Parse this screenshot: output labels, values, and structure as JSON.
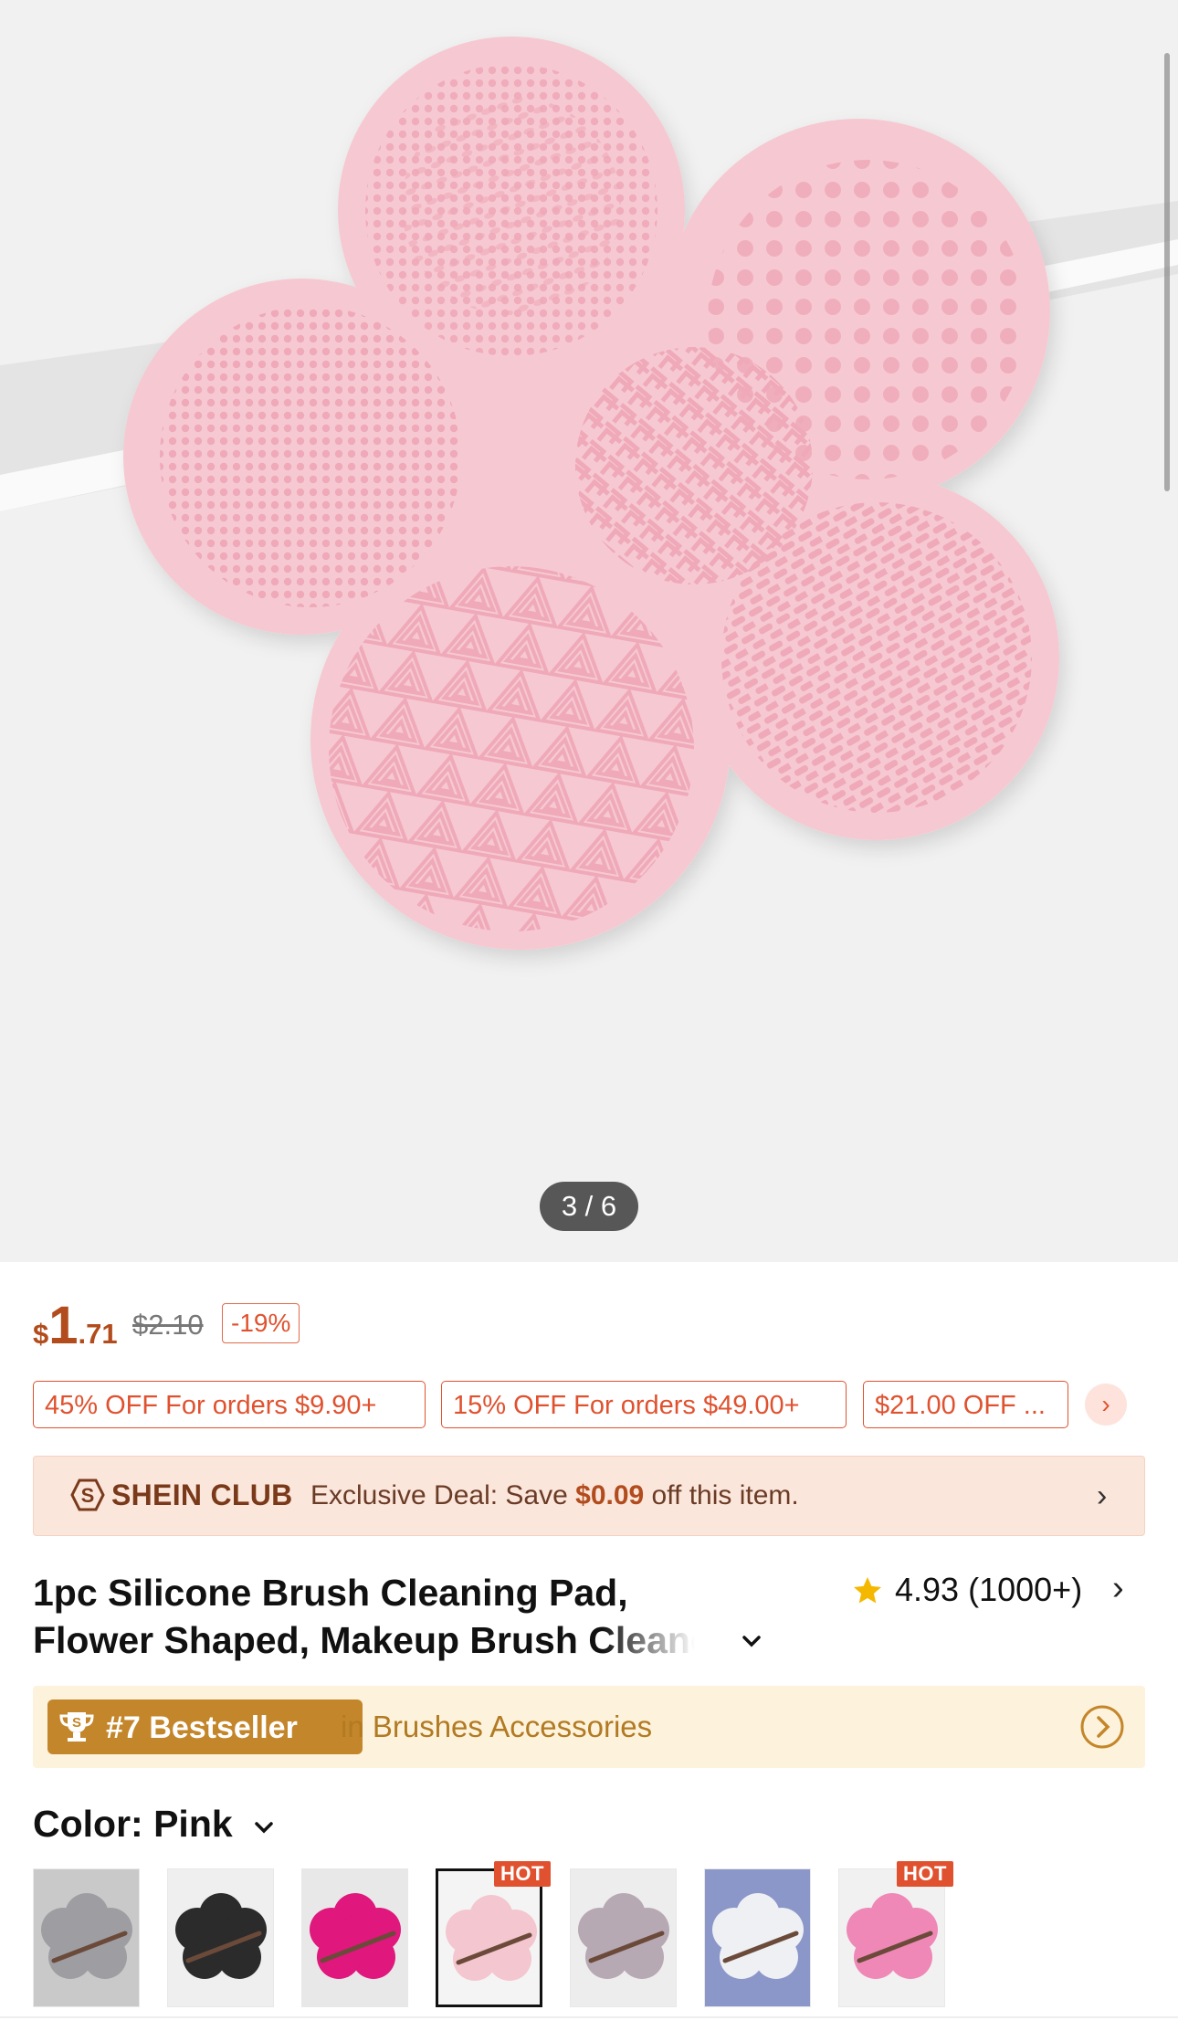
{
  "gallery": {
    "counter": "3 / 6",
    "product_color": "#f6c9d2"
  },
  "price": {
    "currency": "$",
    "integer": "1",
    "decimal": ".71",
    "original": "$2.10",
    "discount": "-19%",
    "color": "#b24c1d"
  },
  "coupons": [
    "45% OFF For orders $9.90+",
    "15% OFF For orders $49.00+",
    "$21.00 OFF ..."
  ],
  "club": {
    "name": "SHEIN CLUB",
    "deal_prefix": "Exclusive Deal: Save ",
    "deal_amount": "$0.09",
    "deal_suffix": " off this item."
  },
  "product": {
    "title_line1": "1pc Silicone Brush Cleaning Pad,",
    "title_line2": "Flower Shaped, Makeup Brush Cleane",
    "rating": "4.93",
    "reviews": "(1000+)"
  },
  "bestseller": {
    "rank": "#7 Bestseller",
    "category": "in Brushes Accessories"
  },
  "color": {
    "label": "Color: Pink",
    "options": [
      {
        "name": "grey",
        "bg": "#c9c9c9",
        "pad": "#9e9ea2",
        "hot": false
      },
      {
        "name": "black",
        "bg": "#efefef",
        "pad": "#2b2b2b",
        "hot": false
      },
      {
        "name": "rose",
        "bg": "#e8e8e8",
        "pad": "#e0177c",
        "hot": false
      },
      {
        "name": "pink",
        "bg": "#f4f4f4",
        "pad": "#f4c6cf",
        "hot": true,
        "selected": true
      },
      {
        "name": "mauve",
        "bg": "#ededed",
        "pad": "#b7a9b3",
        "hot": false
      },
      {
        "name": "white",
        "bg": "#8b96c9",
        "pad": "#eef0f3",
        "hot": false
      },
      {
        "name": "hot-pink",
        "bg": "#f1f1f1",
        "pad": "#ef88b6",
        "hot": true
      }
    ],
    "hot_label": "HOT"
  }
}
